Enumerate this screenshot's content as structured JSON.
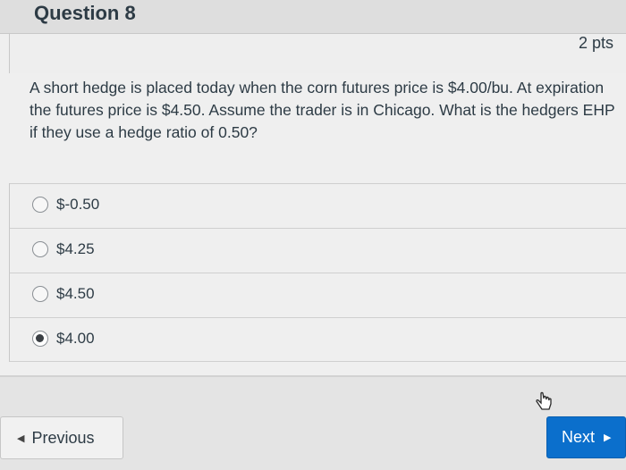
{
  "question": {
    "title": "Question 8",
    "points": "2 pts",
    "text": "A short hedge is placed today when the corn futures price is $4.00/bu. At expiration the futures price is $4.50. Assume the trader is in Chicago. What is the hedgers EHP if they use a hedge ratio of 0.50?"
  },
  "answers": [
    {
      "label": "$-0.50",
      "selected": false
    },
    {
      "label": "$4.25",
      "selected": false
    },
    {
      "label": "$4.50",
      "selected": false
    },
    {
      "label": "$4.00",
      "selected": true
    }
  ],
  "navigation": {
    "previous_label": "Previous",
    "next_label": "Next",
    "previous_icon": "triangle-left-icon",
    "next_icon": "triangle-right-icon"
  },
  "colors": {
    "next_button": "#0b6fcc",
    "text": "#2d3b45"
  }
}
